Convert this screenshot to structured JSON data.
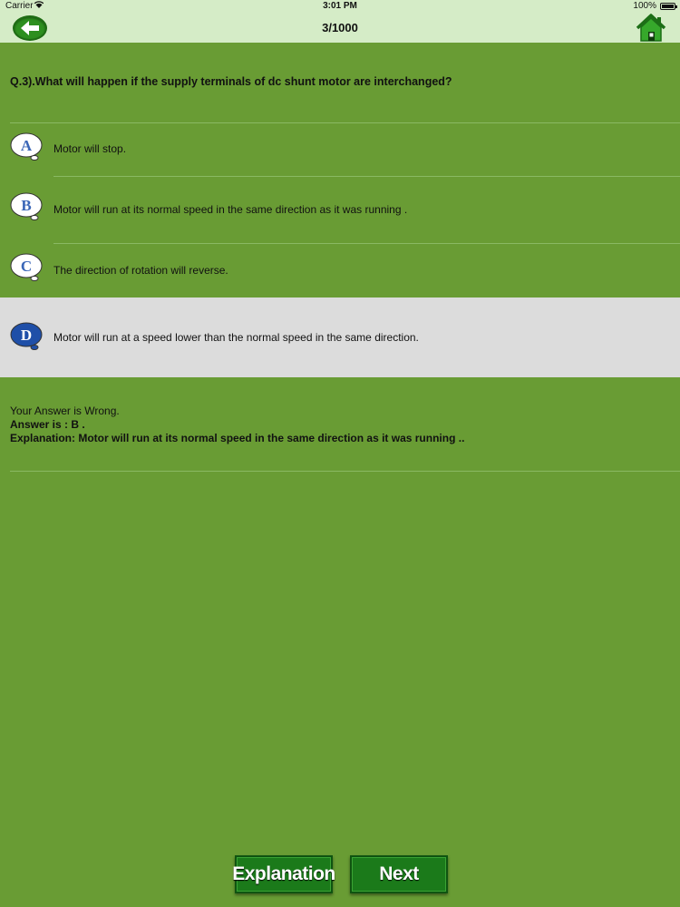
{
  "status_bar": {
    "carrier": "Carrier",
    "time": "3:01 PM",
    "battery": "100%"
  },
  "nav": {
    "title": "3/1000",
    "back_icon": "back-arrow-icon",
    "home_icon": "home-icon"
  },
  "question": {
    "text": "Q.3).What will happen if the supply terminals of dc shunt motor are interchanged?"
  },
  "options": [
    {
      "letter": "A",
      "text": "Motor will stop."
    },
    {
      "letter": "B",
      "text": "Motor will run at its normal speed in the same direction as it was running ."
    },
    {
      "letter": "C",
      "text": "The direction of rotation will reverse."
    },
    {
      "letter": "D",
      "text": "Motor will run at a speed lower than the normal speed in the same direction.",
      "selected": true
    }
  ],
  "result": {
    "status": "Your Answer is Wrong.",
    "answer": "Answer is : B .",
    "explanation": "Explanation: Motor will run at its normal speed in the same direction as it was running .."
  },
  "buttons": {
    "explanation": "Explanation",
    "next": "Next"
  },
  "colors": {
    "background": "#699c34",
    "header": "#d5ecc7",
    "selected_row": "#dcdcdc",
    "letter_default": "#3a66b7",
    "letter_selected": "#1f4fa8",
    "button": "#1b7a1a"
  }
}
